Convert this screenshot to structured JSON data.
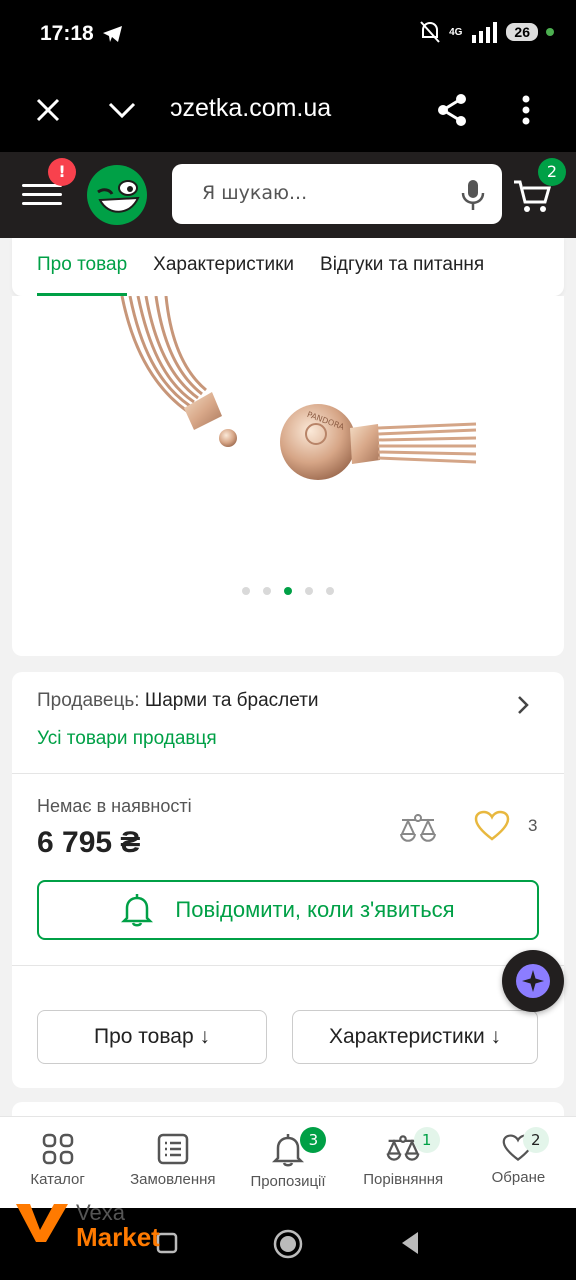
{
  "status_bar": {
    "time": "17:18",
    "network": "4G",
    "battery": "26",
    "icons": [
      "telegram-icon",
      "mute-icon",
      "signal-icon",
      "battery-icon"
    ]
  },
  "browser": {
    "url": "ɔzetka.com.ua",
    "icons": [
      "close-icon",
      "chevron-down-icon",
      "share-icon",
      "more-icon"
    ]
  },
  "header": {
    "menu_badge": "!",
    "search_placeholder": "Я шукаю...",
    "cart_count": "2",
    "icons": [
      "menu-icon",
      "logo-icon",
      "mic-icon",
      "cart-icon"
    ]
  },
  "product_tabs": [
    {
      "label": "Про товар",
      "active": true
    },
    {
      "label": "Характеристики",
      "active": false
    },
    {
      "label": "Відгуки та питання",
      "active": false
    }
  ],
  "gallery": {
    "clasp_text": "PANDORA",
    "dots_total": 5,
    "active_dot": 3
  },
  "seller": {
    "label": "Продавець:",
    "name": "Шарми та браслети",
    "all_products_link": "Усі товари продавця"
  },
  "offer": {
    "availability": "Немає в наявності",
    "price": "6 795 ₴",
    "favorites_count": "3",
    "notify_button": "Повідомити, коли з'явиться",
    "jump_about": "Про товар ↓",
    "jump_specs": "Характеристики ↓"
  },
  "bottom_nav": [
    {
      "label": "Каталог",
      "icon": "catalog-icon",
      "badge": "",
      "name": "nav-catalog"
    },
    {
      "label": "Замовлення",
      "icon": "orders-icon",
      "badge": "",
      "name": "nav-orders"
    },
    {
      "label": "Пропозиції",
      "icon": "bell-icon",
      "badge": "3",
      "name": "nav-offers"
    },
    {
      "label": "Порівняння",
      "icon": "compare-icon",
      "badge": "1",
      "name": "nav-compare"
    },
    {
      "label": "Обране",
      "icon": "heart-icon",
      "badge": "2",
      "name": "nav-favorites"
    }
  ],
  "watermark": {
    "line1": "Vexa",
    "line2": "Market"
  },
  "colors": {
    "accent_green": "#00a046",
    "header_dark": "#221f1f",
    "alert_red": "#f8414d",
    "heart_gold": "#e8b83f",
    "watermark_orange": "#ff7a00"
  }
}
